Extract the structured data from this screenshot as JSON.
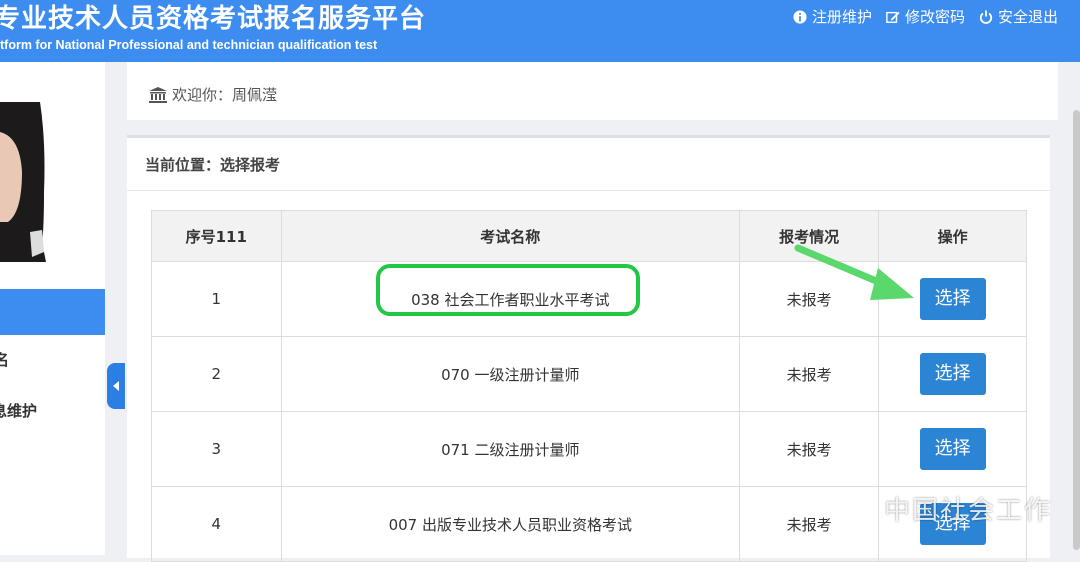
{
  "header": {
    "title_cn": "专业技术人员资格考试报名服务平台",
    "title_en": "tform for National Professional and technician qualification test",
    "links": [
      {
        "label": "注册维护",
        "icon": "info-icon"
      },
      {
        "label": "修改密码",
        "icon": "edit-icon"
      },
      {
        "label": "安全退出",
        "icon": "power-icon"
      }
    ]
  },
  "sidebar": {
    "item1_label": "名",
    "item2_label": "息维护"
  },
  "welcome": {
    "text": "欢迎你：周佩滢",
    "icon": "bank-icon"
  },
  "panel": {
    "breadcrumb": "当前位置：选择报考"
  },
  "table": {
    "headers": [
      "序号111",
      "考试名称",
      "报考情况",
      "操作"
    ],
    "rows": [
      {
        "no": "1",
        "name": "038 社会工作者职业水平考试",
        "status": "未报考",
        "action": "选择"
      },
      {
        "no": "2",
        "name": "070 一级注册计量师",
        "status": "未报考",
        "action": "选择"
      },
      {
        "no": "3",
        "name": "071 二级注册计量师",
        "status": "未报考",
        "action": "选择"
      },
      {
        "no": "4",
        "name": "007 出版专业技术人员职业资格考试",
        "status": "未报考",
        "action": "选择"
      }
    ]
  },
  "watermark": "中国社会工作",
  "colors": {
    "header_bg": "#3d8cef",
    "button_bg": "#2c84d5",
    "highlight": "#22c743",
    "arrow": "#5ad86c"
  }
}
